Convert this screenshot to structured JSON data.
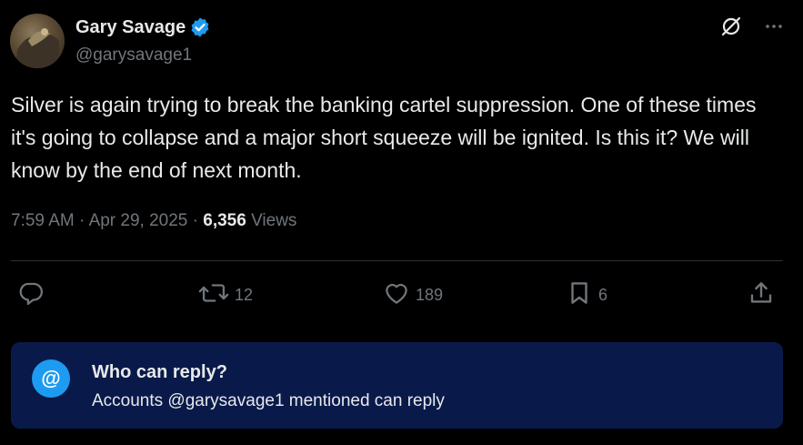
{
  "author": {
    "name": "Gary Savage",
    "handle": "@garysavage1",
    "verified": true
  },
  "tweet": {
    "text": "Silver is again trying to break the banking cartel suppression. One of these times it's going to collapse and a major short squeeze will be ignited. Is this it? We will know by the end of next month.",
    "time": "7:59 AM",
    "separator": "·",
    "date": "Apr 29, 2025",
    "views_count": "6,356",
    "views_label": "Views"
  },
  "actions": {
    "reply_count": "",
    "retweet_count": "12",
    "like_count": "189",
    "bookmark_count": "6"
  },
  "reply_settings": {
    "icon_glyph": "@",
    "title": "Who can reply?",
    "description": "Accounts @garysavage1 mentioned can reply"
  },
  "colors": {
    "background": "#000000",
    "text_primary": "#e7e9ea",
    "text_secondary": "#71767b",
    "accent": "#1d9bf0",
    "card_background": "#091a4a",
    "divider": "#2f3336"
  },
  "icons": {
    "verified": "verified-badge-icon",
    "grok": "grok-icon",
    "more": "more-icon",
    "reply": "reply-icon",
    "retweet": "retweet-icon",
    "like": "heart-icon",
    "bookmark": "bookmark-icon",
    "share": "share-icon"
  }
}
